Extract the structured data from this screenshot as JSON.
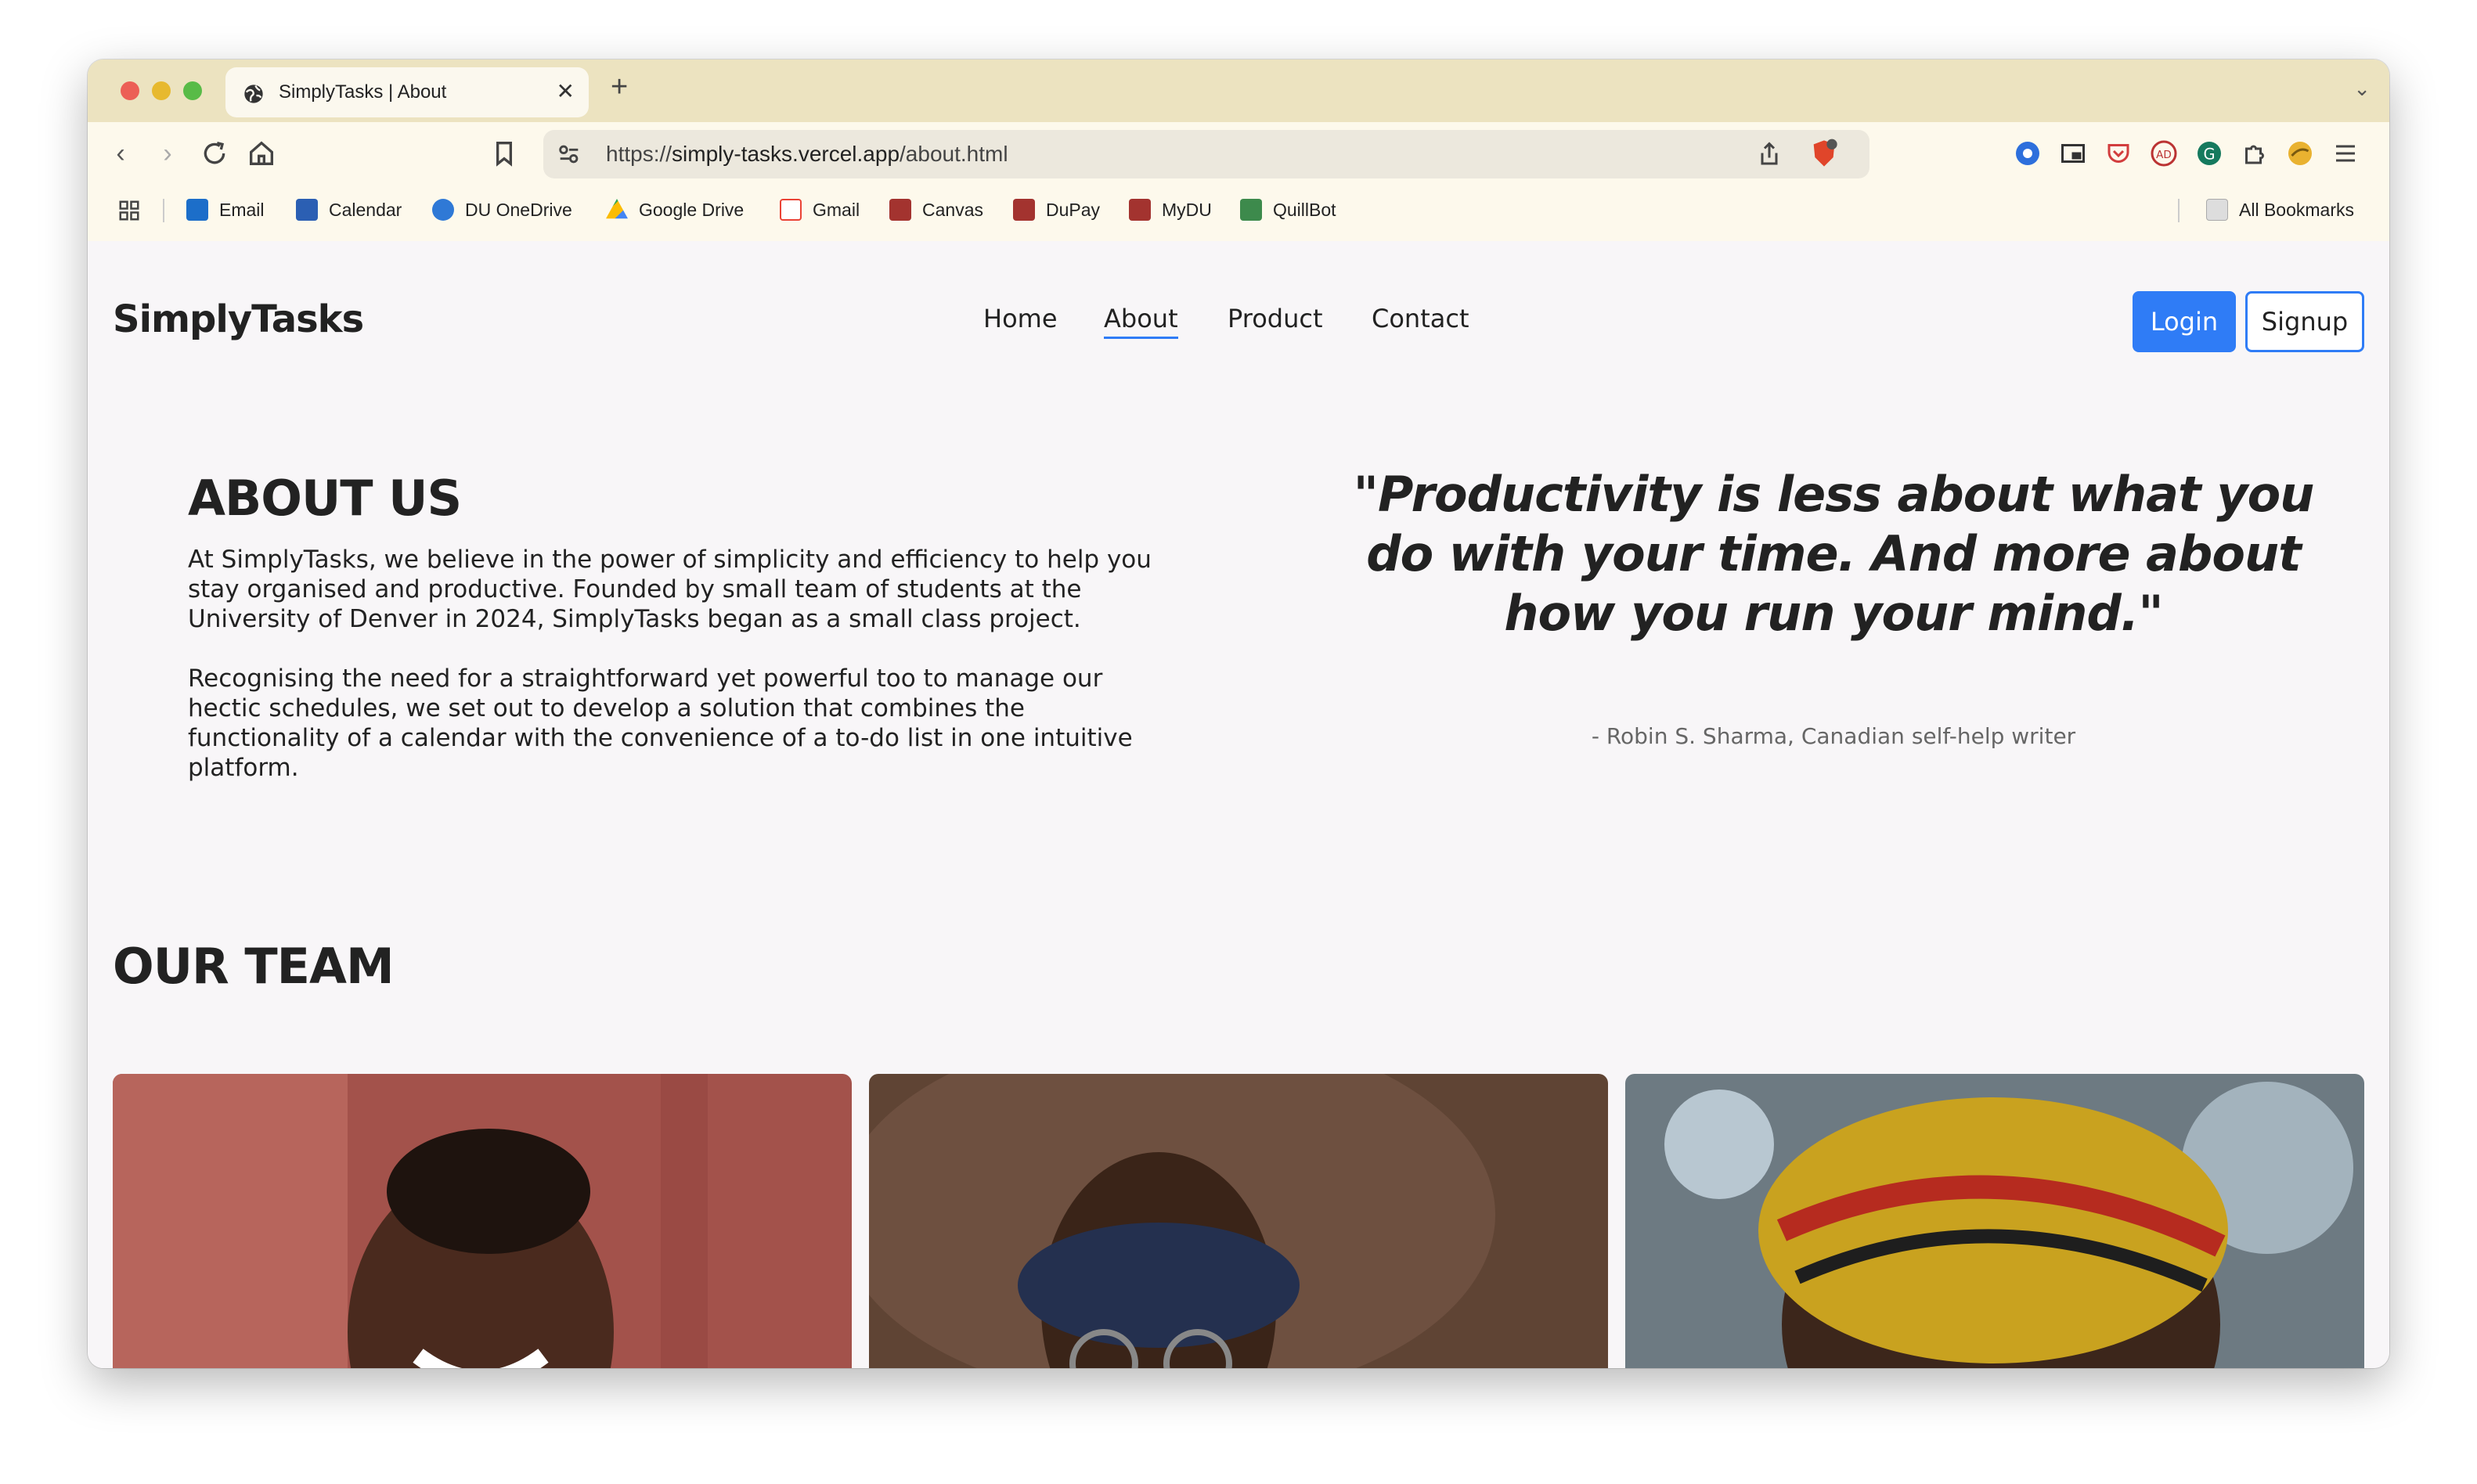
{
  "browser": {
    "tab_title": "SimplyTasks | About",
    "url_prefix": "https://",
    "url_host": "simply-tasks.vercel.app",
    "url_path": "/about.html",
    "bookmarks": [
      "Email",
      "Calendar",
      "DU OneDrive",
      "Google Drive",
      "Gmail",
      "Canvas",
      "DuPay",
      "MyDU",
      "QuillBot"
    ],
    "all_bookmarks": "All Bookmarks"
  },
  "site": {
    "logo": "SimplyTasks",
    "nav": [
      "Home",
      "About",
      "Product",
      "Contact"
    ],
    "active_nav": "About",
    "login": "Login",
    "signup": "Signup"
  },
  "about": {
    "title": "ABOUT US",
    "paragraph1": "At SimplyTasks, we believe in the power of simplicity and efficiency to help you stay organised and productive. Founded by small team of students at the University of Denver in 2024, SimplyTasks began as a small class project.",
    "paragraph2": "Recognising the need for a straightforward yet powerful too to manage our hectic schedules, we set out to develop a solution that combines the functionality of a calendar with the convenience of a to-do list in one intuitive platform."
  },
  "quote": {
    "text": "\"Productivity is less about what you do with your time. And more about how you run your mind.\"",
    "author": "- Robin S. Sharma, Canadian self-help writer"
  },
  "team": {
    "title": "OUR TEAM"
  },
  "colors": {
    "accent": "#2f7cf6",
    "tabbar": "#ece3c0",
    "toolbar": "#fdf9ec"
  }
}
